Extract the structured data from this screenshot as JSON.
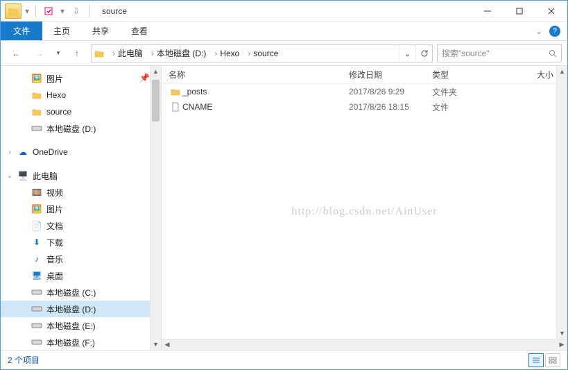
{
  "window": {
    "title": "source"
  },
  "ribbon": {
    "file": "文件",
    "tabs": [
      "主页",
      "共享",
      "查看"
    ]
  },
  "breadcrumb": [
    "此电脑",
    "本地磁盘 (D:)",
    "Hexo",
    "source"
  ],
  "search": {
    "placeholder": "搜索\"source\""
  },
  "columns": {
    "name": "名称",
    "date": "修改日期",
    "type": "类型",
    "size": "大小"
  },
  "files": [
    {
      "name": "_posts",
      "date": "2017/8/26 9:29",
      "type": "文件夹",
      "kind": "folder"
    },
    {
      "name": "CNAME",
      "date": "2017/8/26 18:15",
      "type": "文件",
      "kind": "file"
    }
  ],
  "tree": {
    "quick": [
      {
        "label": "图片",
        "icon": "pictures"
      },
      {
        "label": "Hexo",
        "icon": "folder"
      },
      {
        "label": "source",
        "icon": "folder"
      },
      {
        "label": "本地磁盘 (D:)",
        "icon": "drive"
      }
    ],
    "onedrive": "OneDrive",
    "thispc": "此电脑",
    "pc": [
      {
        "label": "视频",
        "icon": "videos"
      },
      {
        "label": "图片",
        "icon": "pictures"
      },
      {
        "label": "文档",
        "icon": "documents"
      },
      {
        "label": "下载",
        "icon": "downloads"
      },
      {
        "label": "音乐",
        "icon": "music"
      },
      {
        "label": "桌面",
        "icon": "desktop"
      },
      {
        "label": "本地磁盘 (C:)",
        "icon": "drive"
      },
      {
        "label": "本地磁盘 (D:)",
        "icon": "drive",
        "selected": true
      },
      {
        "label": "本地磁盘 (E:)",
        "icon": "drive"
      },
      {
        "label": "本地磁盘 (F:)",
        "icon": "drive"
      }
    ]
  },
  "status": {
    "text": "2 个项目"
  },
  "watermark": "http://blog.csdn.net/AinUser"
}
